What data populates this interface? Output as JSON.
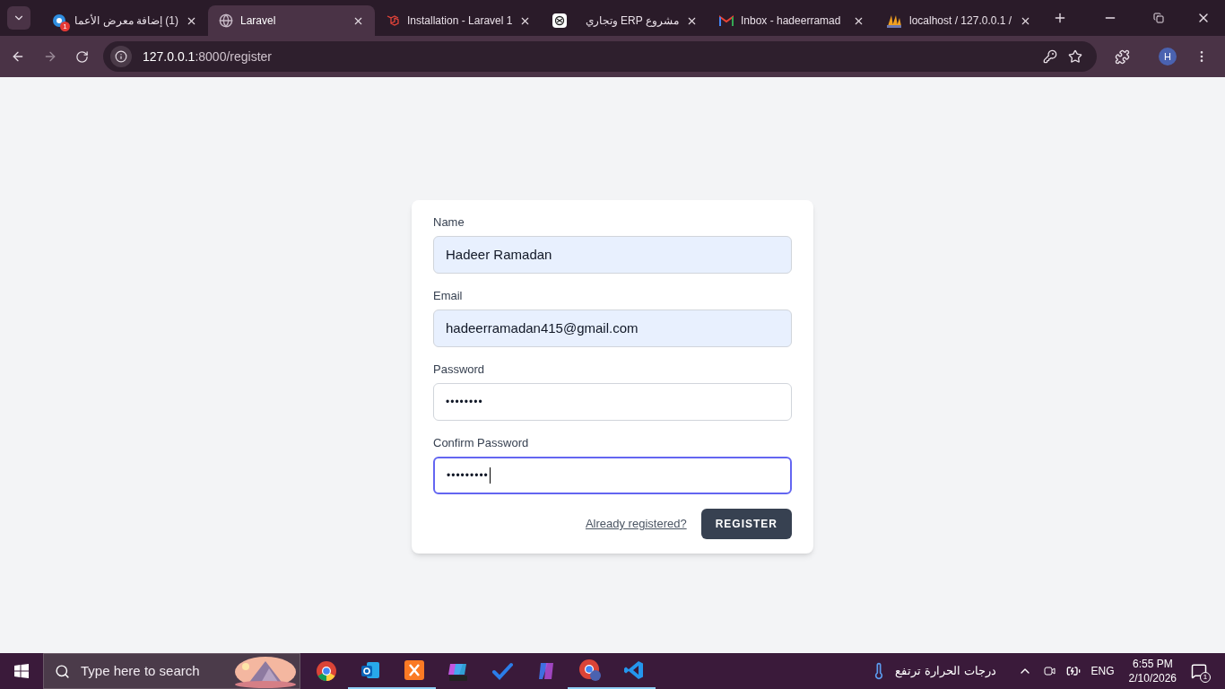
{
  "tabs": [
    {
      "title": "(1) إضافة معرض الأعما",
      "kind": "badge-globe",
      "badge": "1",
      "selected": false
    },
    {
      "title": "Laravel",
      "kind": "globe",
      "selected": true
    },
    {
      "title": "Installation - Laravel 1",
      "kind": "cube",
      "selected": false
    },
    {
      "title": "مشروع ERP وتجاري",
      "kind": "knot",
      "selected": false
    },
    {
      "title": "Inbox - hadeerramad",
      "kind": "mail",
      "selected": false
    },
    {
      "title": "localhost / 127.0.0.1 /",
      "kind": "sails",
      "selected": false
    }
  ],
  "address_bar": {
    "url_host": "127.0.0.1",
    "url_rest": ":8000/register"
  },
  "profile": {
    "initial": "H"
  },
  "form": {
    "fields": [
      {
        "label": "Name",
        "value": "Hadeer Ramadan",
        "autofilled": true,
        "focused": false,
        "kind": "text"
      },
      {
        "label": "Email",
        "value": "hadeerramadan415@gmail.com",
        "autofilled": true,
        "focused": false,
        "kind": "text"
      },
      {
        "label": "Password",
        "value": "••••••••",
        "autofilled": false,
        "focused": false,
        "kind": "password"
      },
      {
        "label": "Confirm Password",
        "value": "•••••••••",
        "autofilled": false,
        "focused": true,
        "kind": "password"
      }
    ],
    "link": "Already registered?",
    "button": "REGISTER"
  },
  "taskbar": {
    "search_placeholder": "Type here to search",
    "apps": [
      {
        "kind": "chrome",
        "running": false
      },
      {
        "kind": "outlook",
        "running": true
      },
      {
        "kind": "xampp",
        "running": true
      },
      {
        "kind": "office",
        "running": false
      },
      {
        "kind": "todo",
        "running": false
      },
      {
        "kind": "copilot",
        "running": false
      },
      {
        "kind": "chrome-profile",
        "running": true
      },
      {
        "kind": "vscode",
        "running": true
      }
    ],
    "weather": "درجات الحرارة ترتفع",
    "language": "ENG",
    "time": "6:55 PM",
    "date": "2/10/2026",
    "notifications": "1"
  }
}
